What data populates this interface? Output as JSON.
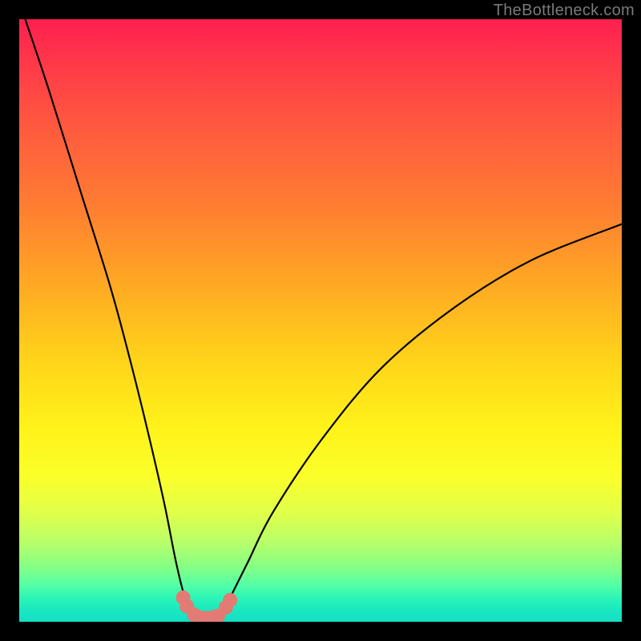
{
  "watermark": "TheBottleneck.com",
  "chart_data": {
    "type": "line",
    "title": "",
    "xlabel": "",
    "ylabel": "",
    "xlim": [
      0,
      100
    ],
    "ylim": [
      0,
      100
    ],
    "series": [
      {
        "name": "bottleneck-curve",
        "x": [
          1,
          5,
          10,
          15,
          18,
          21,
          24,
          26,
          27.5,
          29,
          30,
          31,
          32,
          33,
          34,
          35,
          36,
          38,
          42,
          50,
          60,
          72,
          85,
          100
        ],
        "y": [
          100,
          88,
          72,
          56,
          45,
          33,
          20,
          10,
          4,
          1,
          0.4,
          0.4,
          0.5,
          1,
          2,
          4,
          6,
          10,
          18,
          30,
          42,
          52,
          60,
          66
        ]
      }
    ],
    "markers": {
      "name": "highlight-dots",
      "x": [
        27.2,
        27.8,
        29.0,
        30.0,
        31.0,
        32.0,
        33.0,
        34.3,
        35.0
      ],
      "y": [
        4.0,
        2.6,
        1.2,
        0.7,
        0.6,
        0.7,
        1.0,
        2.4,
        3.6
      ]
    },
    "colors": {
      "curve": "#000000",
      "markers": "#e17b74",
      "gradient_top": "#ff1f4f",
      "gradient_bottom": "#14dec6"
    }
  }
}
